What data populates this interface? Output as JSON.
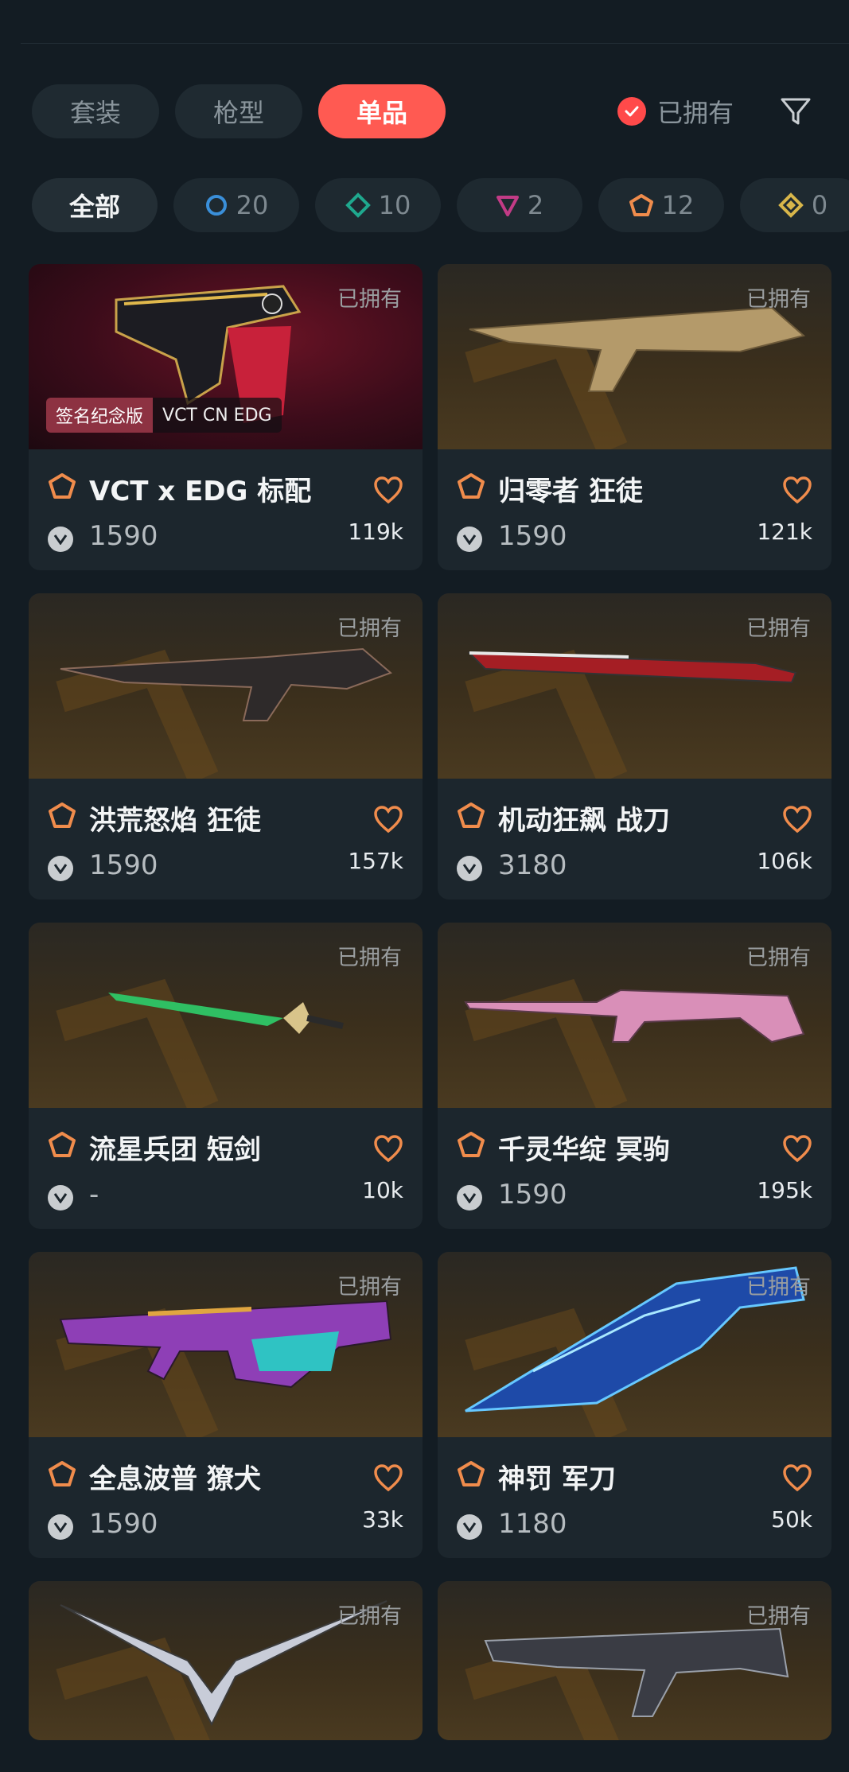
{
  "tabs": [
    {
      "label": "套装",
      "active": false
    },
    {
      "label": "枪型",
      "active": false
    },
    {
      "label": "单品",
      "active": true
    }
  ],
  "owned_filter": {
    "label": "已拥有",
    "checked": true
  },
  "rarity_chips": [
    {
      "label": "全部",
      "icon": "all",
      "count": ""
    },
    {
      "label": "",
      "icon": "select-tier-icon",
      "count": "20",
      "color": "#3a8fd9"
    },
    {
      "label": "",
      "icon": "deluxe-tier-icon",
      "count": "10",
      "color": "#1fa88e"
    },
    {
      "label": "",
      "icon": "premium-tier-icon",
      "count": "2",
      "color": "#c23b86"
    },
    {
      "label": "",
      "icon": "exclusive-tier-icon",
      "count": "12",
      "color": "#f08c4c"
    },
    {
      "label": "",
      "icon": "ultra-tier-icon",
      "count": "0",
      "color": "#d8b64a"
    }
  ],
  "items": [
    {
      "name": "VCT x EDG 标配",
      "owned": "已拥有",
      "price": "1590",
      "likes": "119k",
      "badge": [
        "签名纪念版",
        "VCT CN EDG"
      ],
      "art": "red"
    },
    {
      "name": "归零者 狂徒",
      "owned": "已拥有",
      "price": "1590",
      "likes": "121k"
    },
    {
      "name": "洪荒怒焰 狂徒",
      "owned": "已拥有",
      "price": "1590",
      "likes": "157k"
    },
    {
      "name": "机动狂飙 战刀",
      "owned": "已拥有",
      "price": "3180",
      "likes": "106k"
    },
    {
      "name": "流星兵团 短剑",
      "owned": "已拥有",
      "price": "-",
      "likes": "10k"
    },
    {
      "name": "千灵华绽 冥驹",
      "owned": "已拥有",
      "price": "1590",
      "likes": "195k"
    },
    {
      "name": "全息波普 獠犬",
      "owned": "已拥有",
      "price": "1590",
      "likes": "33k"
    },
    {
      "name": "神罚 军刀",
      "owned": "已拥有",
      "price": "1180",
      "likes": "50k"
    },
    {
      "name": "",
      "owned": "已拥有",
      "price": "",
      "likes": ""
    },
    {
      "name": "",
      "owned": "已拥有",
      "price": "",
      "likes": ""
    }
  ],
  "colors": {
    "accent": "#ff5a52",
    "tier_exclusive": "#f08c4c",
    "background": "#131c23"
  }
}
